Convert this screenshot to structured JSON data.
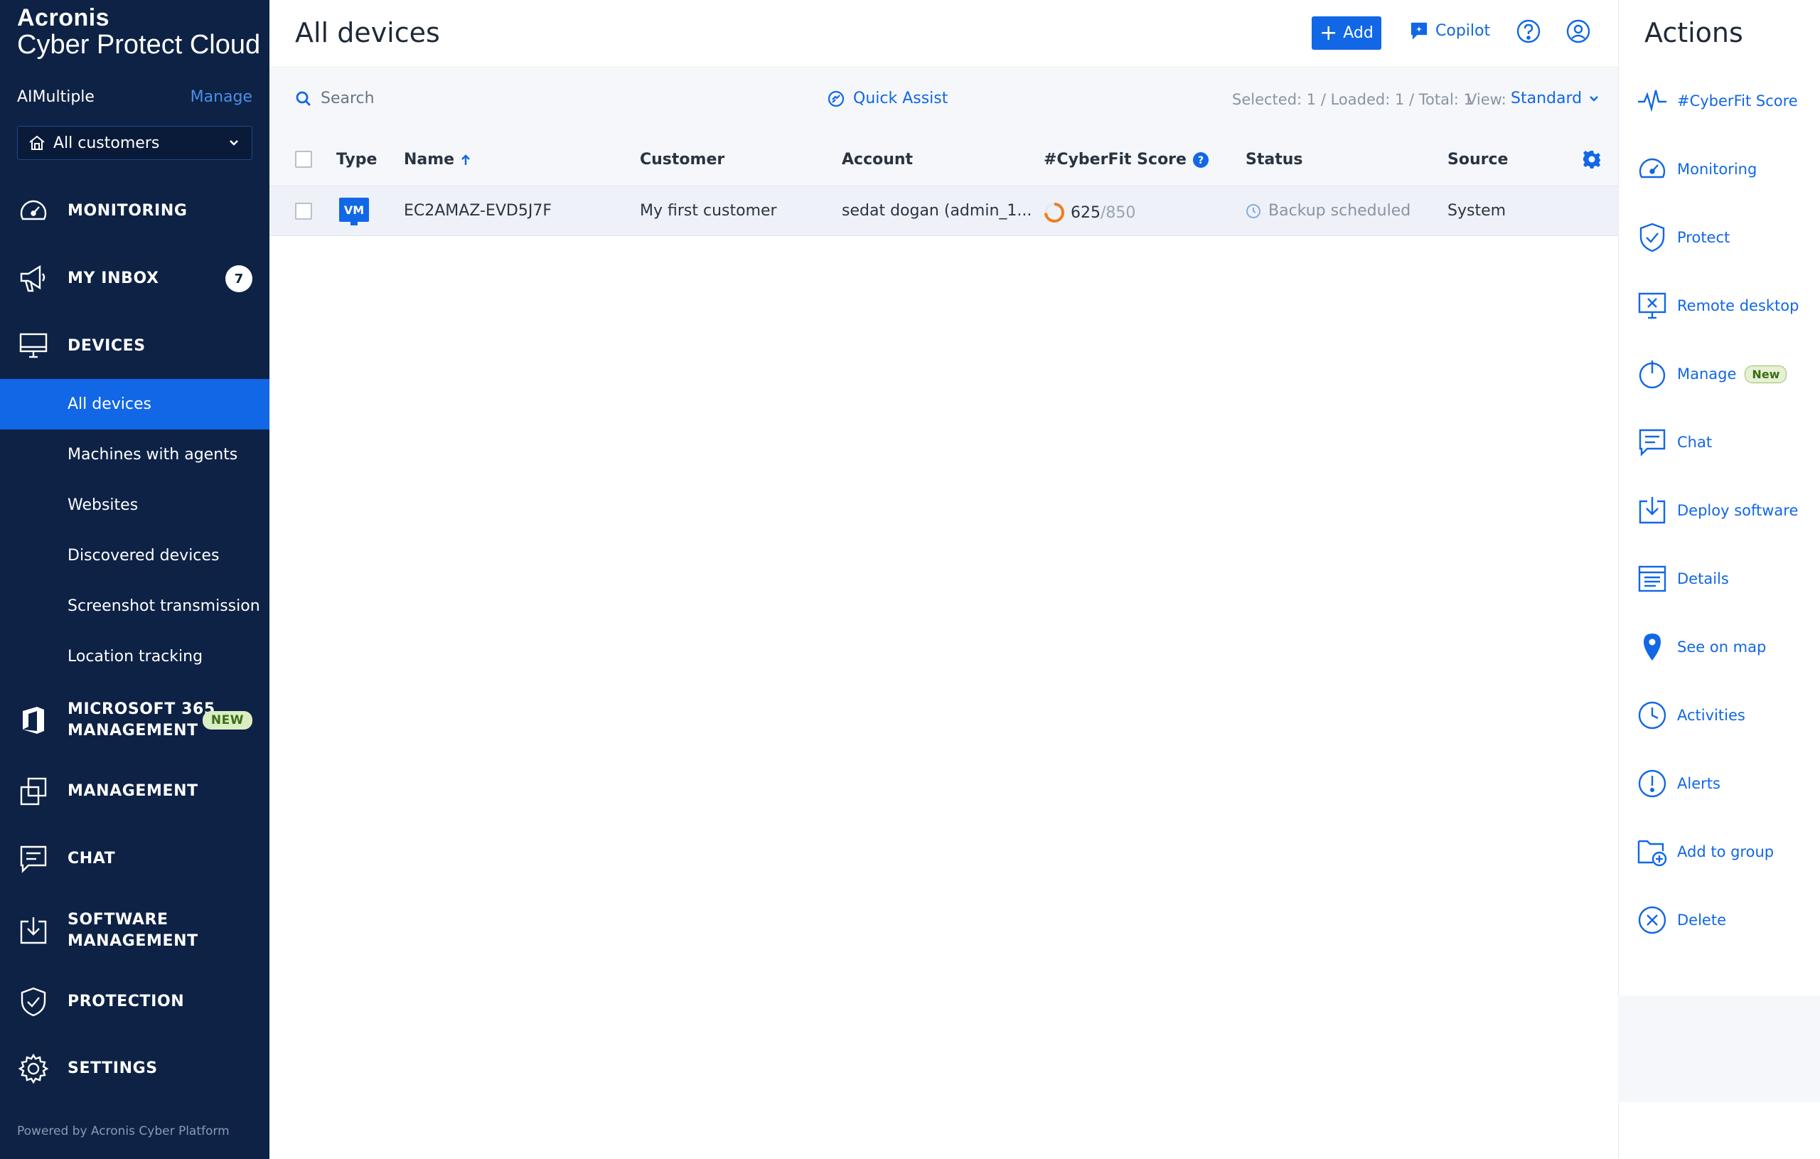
{
  "brand": {
    "line1": "Acronis",
    "line2": "Cyber Protect Cloud"
  },
  "tenant": {
    "name": "AIMultiple",
    "manage_label": "Manage"
  },
  "customer_select": {
    "value": "All customers"
  },
  "nav": {
    "monitoring": "MONITORING",
    "inbox": "MY INBOX",
    "inbox_count": "7",
    "devices": "DEVICES",
    "devices_sub": [
      "All devices",
      "Machines with agents",
      "Websites",
      "Discovered devices",
      "Screenshot transmission",
      "Location tracking"
    ],
    "m365_l1": "MICROSOFT 365",
    "m365_l2": "MANAGEMENT",
    "m365_badge": "NEW",
    "management": "MANAGEMENT",
    "chat": "CHAT",
    "software_l1": "SOFTWARE",
    "software_l2": "MANAGEMENT",
    "protection": "PROTECTION",
    "settings": "SETTINGS"
  },
  "footer": {
    "powered_by": "Powered by Acronis Cyber Platform"
  },
  "header": {
    "title": "All devices",
    "add_label": "Add",
    "copilot_label": "Copilot"
  },
  "toolbar": {
    "search_placeholder": "Search",
    "quick_assist": "Quick Assist",
    "counts": "Selected: 1 / Loaded: 1 / Total: 1",
    "view_label": "View:",
    "view_value": "Standard"
  },
  "table": {
    "columns": [
      "Type",
      "Name",
      "Customer",
      "Account",
      "#CyberFit Score",
      "Status",
      "Source"
    ],
    "rows": [
      {
        "type": "VM",
        "name": "EC2AMAZ-EVD5J7F",
        "customer": "My first customer",
        "account": "sedat dogan (admin_1...",
        "score": "625",
        "score_max": "/850",
        "status": "Backup scheduled",
        "source": "System"
      }
    ]
  },
  "actions": {
    "title": "Actions",
    "items": [
      {
        "label": "#CyberFit Score",
        "icon": "pulse-icon"
      },
      {
        "label": "Monitoring",
        "icon": "gauge-icon"
      },
      {
        "label": "Protect",
        "icon": "shield-icon"
      },
      {
        "label": "Remote desktop",
        "icon": "remote-desktop-icon"
      },
      {
        "label": "Manage",
        "icon": "power-icon",
        "badge": "New"
      },
      {
        "label": "Chat",
        "icon": "chat-icon"
      },
      {
        "label": "Deploy software",
        "icon": "deploy-icon"
      },
      {
        "label": "Details",
        "icon": "details-icon"
      },
      {
        "label": "See on map",
        "icon": "map-pin-icon"
      },
      {
        "label": "Activities",
        "icon": "clock-icon"
      },
      {
        "label": "Alerts",
        "icon": "alert-icon"
      },
      {
        "label": "Add to group",
        "icon": "folder-plus-icon"
      },
      {
        "label": "Delete",
        "icon": "delete-icon"
      }
    ]
  },
  "colors": {
    "sidebar_bg": "#0d2245",
    "accent": "#1167e6",
    "badge_green": "#dbedc2",
    "score_ring": "#f07c1e"
  }
}
